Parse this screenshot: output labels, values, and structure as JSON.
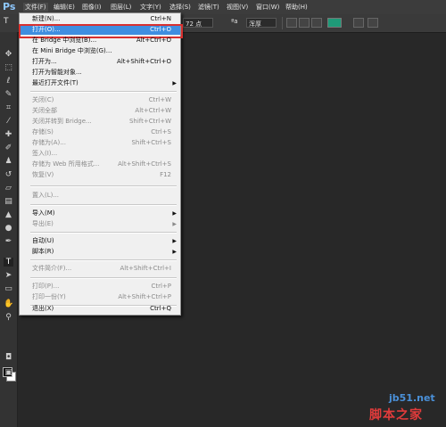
{
  "app": {
    "logo": "Ps"
  },
  "menubar": [
    {
      "label": "文件(F)"
    },
    {
      "label": "编辑(E)"
    },
    {
      "label": "图像(I)"
    },
    {
      "label": "图层(L)"
    },
    {
      "label": "文字(Y)"
    },
    {
      "label": "选择(S)"
    },
    {
      "label": "滤镜(T)"
    },
    {
      "label": "视图(V)"
    },
    {
      "label": "窗口(W)"
    },
    {
      "label": "帮助(H)"
    }
  ],
  "options_bar": {
    "tool_icon": "T",
    "font_size": "72 点",
    "aa_icon": "ªa",
    "antialias": "浑厚",
    "swatch_color": "#1f9a78"
  },
  "file_menu": [
    {
      "label": "新建(N)...",
      "shortcut": "Ctrl+N",
      "enabled": true
    },
    {
      "label": "打开(O)...",
      "shortcut": "Ctrl+O",
      "enabled": true,
      "highlighted": true
    },
    {
      "label": "在 Bridge 中浏览(B)...",
      "shortcut": "Alt+Ctrl+O",
      "enabled": true
    },
    {
      "label": "在 Mini Bridge 中浏览(G)...",
      "shortcut": "",
      "enabled": true
    },
    {
      "label": "打开为...",
      "shortcut": "Alt+Shift+Ctrl+O",
      "enabled": true
    },
    {
      "label": "打开为智能对象...",
      "shortcut": "",
      "enabled": true
    },
    {
      "label": "最近打开文件(T)",
      "shortcut": "",
      "enabled": true,
      "submenu": true
    },
    {
      "label": "关闭(C)",
      "shortcut": "Ctrl+W",
      "enabled": false
    },
    {
      "label": "关闭全部",
      "shortcut": "Alt+Ctrl+W",
      "enabled": false
    },
    {
      "label": "关闭并转到 Bridge...",
      "shortcut": "Shift+Ctrl+W",
      "enabled": false
    },
    {
      "label": "存储(S)",
      "shortcut": "Ctrl+S",
      "enabled": false
    },
    {
      "label": "存储为(A)...",
      "shortcut": "Shift+Ctrl+S",
      "enabled": false
    },
    {
      "label": "签入(I)...",
      "shortcut": "",
      "enabled": false
    },
    {
      "label": "存储为 Web 所用格式...",
      "shortcut": "Alt+Shift+Ctrl+S",
      "enabled": false
    },
    {
      "label": "恢复(V)",
      "shortcut": "F12",
      "enabled": false
    },
    {
      "label": "置入(L)...",
      "shortcut": "",
      "enabled": false
    },
    {
      "label": "导入(M)",
      "shortcut": "",
      "enabled": true,
      "submenu": true
    },
    {
      "label": "导出(E)",
      "shortcut": "",
      "enabled": false,
      "submenu": true
    },
    {
      "label": "自动(U)",
      "shortcut": "",
      "enabled": true,
      "submenu": true
    },
    {
      "label": "脚本(R)",
      "shortcut": "",
      "enabled": true,
      "submenu": true
    },
    {
      "label": "文件简介(F)...",
      "shortcut": "Alt+Shift+Ctrl+I",
      "enabled": false
    },
    {
      "label": "打印(P)...",
      "shortcut": "Ctrl+P",
      "enabled": false
    },
    {
      "label": "打印一份(Y)",
      "shortcut": "Alt+Shift+Ctrl+P",
      "enabled": false
    },
    {
      "label": "退出(X)",
      "shortcut": "Ctrl+Q",
      "enabled": true
    }
  ],
  "watermark": {
    "site": "jb51.net",
    "text": "脚本之家"
  },
  "icons": [
    "move-icon",
    "marquee-icon",
    "lasso-icon",
    "quick-select-icon",
    "crop-icon",
    "eyedropper-icon",
    "healing-brush-icon",
    "brush-icon",
    "clone-stamp-icon",
    "history-brush-icon",
    "eraser-icon",
    "gradient-icon",
    "blur-icon",
    "dodge-icon",
    "pen-icon",
    "type-icon",
    "path-select-icon",
    "shape-icon",
    "hand-icon",
    "zoom-icon"
  ]
}
